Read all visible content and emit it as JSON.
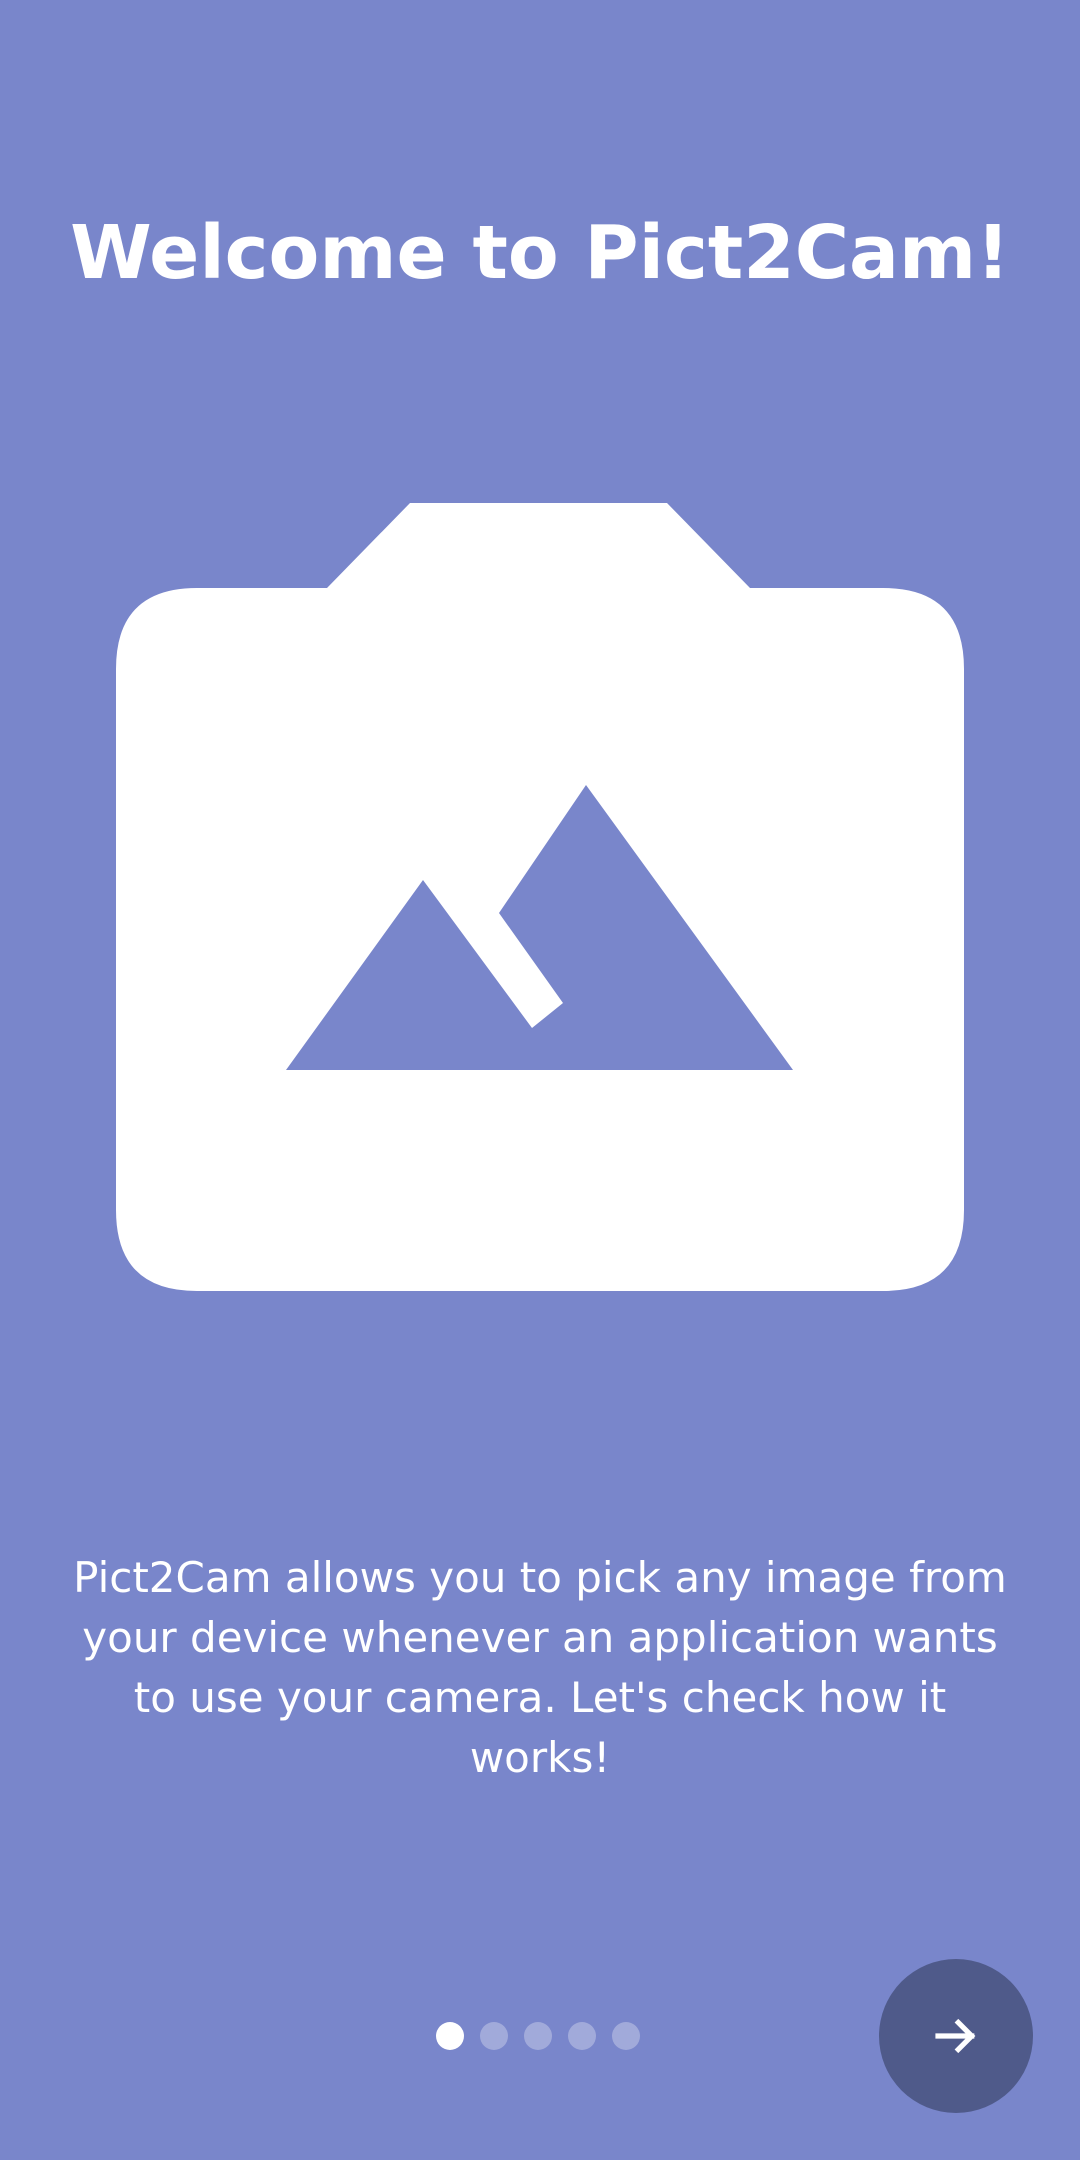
{
  "onboarding": {
    "title": "Welcome to Pict2Cam!",
    "description": "Pict2Cam allows you to pick any image from your device whenever an application wants to use your camera. Let's check how it works!",
    "hero_icon": "camera-with-mountain-icon",
    "page_indicator": {
      "current": 1,
      "total": 5
    },
    "next_button_icon": "arrow-right-icon"
  },
  "colors": {
    "background": "#7986CB",
    "foreground": "#FFFFFF",
    "fab": "#4F5A8A",
    "inactive_dot": "rgba(255,255,255,0.3)"
  }
}
